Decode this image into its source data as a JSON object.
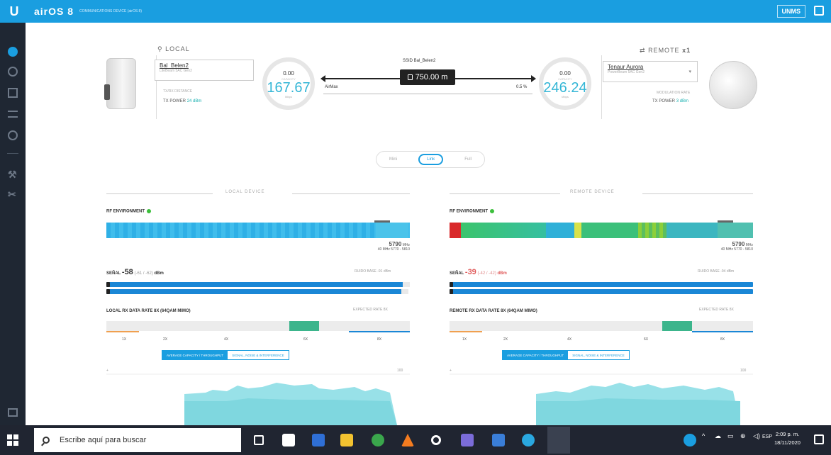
{
  "header": {
    "brand": "airOS 8",
    "subtitle": "COMMUNICATIONS DEVICE (airOS 8)",
    "unms_label": "UNMS"
  },
  "local": {
    "title": "LOCAL",
    "device_name": "Bal_Belen2",
    "device_model": "LiteBeam 5AC Gen2",
    "sub_label": "TX/RX DISTANCE",
    "txpower_label": "TX POWER",
    "txpower_value": "24 dBm",
    "gauge_top": "0.00",
    "gauge_label": "CAPACITY",
    "gauge_value": "167.67",
    "gauge_unit": "Mbps",
    "section_title": "LOCAL DEVICE",
    "rf_title": "RF ENVIRONMENT",
    "freq_value": "5790",
    "freq_unit": "MHz",
    "freq_range": "40 MHz 5770 - 5810",
    "signal_label": "SEÑAL",
    "signal_value": "-58",
    "signal_chains": "(-61 / -62)",
    "signal_unit": "dBm",
    "noise": "RUIDO BASE -91 dBm",
    "rate_title": "LOCAL RX DATA RATE 8X (64QAM MIMO)",
    "expected": "EXPECTED RATE 8X",
    "rate_ticks": [
      "1X",
      "2X",
      "4X",
      "6X",
      "8X"
    ],
    "tab_1": "AVERAGE CAPACITY / THROUGHPUT",
    "tab_2": "SIGNAL, NOISE & INTERFERENCE",
    "chart_max": "100"
  },
  "link": {
    "ssid": "SSID  Bal_Belen2",
    "distance": "750.00 m",
    "mode": "AirMax",
    "airtime": "0.5 %"
  },
  "remote": {
    "title": "REMOTE",
    "count": "x1",
    "device_name": "Tenaur Aurora",
    "device_model": "PowerBeam 5AC Gen2",
    "sub_label": "MODULATION RATE",
    "txpower_label": "TX POWER",
    "txpower_value": "3 dBm",
    "gauge_top": "0.00",
    "gauge_label": "CAPACITY",
    "gauge_value": "246.24",
    "gauge_unit": "Mbps",
    "section_title": "REMOTE DEVICE",
    "rf_title": "RF ENVIRONMENT",
    "freq_value": "5790",
    "freq_unit": "MHz",
    "freq_range": "40 MHz 5770 - 5810",
    "signal_label": "SEÑAL",
    "signal_value": "-39",
    "signal_chains": "(-42 / -42)",
    "signal_unit": "dBm",
    "noise": "RUIDO BASE -94 dBm",
    "rate_title": "REMOTE RX DATA RATE 8X (64QAM MIMO)",
    "expected": "EXPECTED RATE 8X",
    "rate_ticks": [
      "1X",
      "2X",
      "4X",
      "6X",
      "8X"
    ],
    "tab_1": "AVERAGE CAPACITY / THROUGHPUT",
    "tab_2": "SIGNAL, NOISE & INTERFERENCE",
    "chart_max": "100"
  },
  "view_toggle": {
    "options": [
      "Mini",
      "Link",
      "Full"
    ],
    "selected": "Link"
  },
  "taskbar": {
    "search_placeholder": "Escribe aquí para buscar",
    "lang": "ESP",
    "time": "2:09 p. m.",
    "date": "18/11/2020"
  },
  "colors": {
    "accent": "#1a9ee0",
    "capacity": "#34b6d6",
    "rate_highlight": "#3cb58c",
    "signal_bad": "#e05b5b"
  }
}
